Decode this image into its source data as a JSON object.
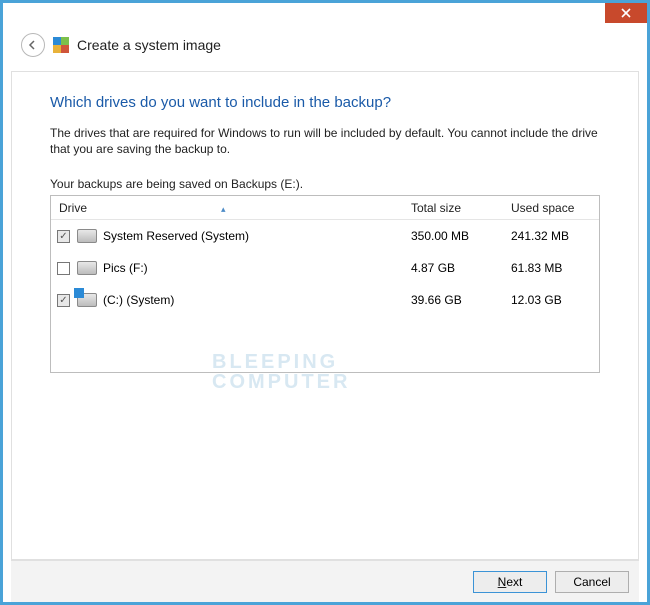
{
  "window": {
    "title": "Create a system image"
  },
  "content": {
    "question": "Which drives do you want to include in the backup?",
    "description": "The drives that are required for Windows to run will be included by default. You cannot include the drive that you are saving the backup to.",
    "save_location": "Your backups are being saved on Backups (E:)."
  },
  "table": {
    "headers": {
      "drive": "Drive",
      "total": "Total size",
      "used": "Used space"
    },
    "rows": [
      {
        "checked": true,
        "disabled": true,
        "system_badge": false,
        "name": "System Reserved (System)",
        "total": "350.00 MB",
        "used": "241.32 MB"
      },
      {
        "checked": false,
        "disabled": false,
        "system_badge": false,
        "name": "Pics (F:)",
        "total": "4.87 GB",
        "used": "61.83 MB"
      },
      {
        "checked": true,
        "disabled": true,
        "system_badge": true,
        "name": "(C:) (System)",
        "total": "39.66 GB",
        "used": "12.03 GB"
      }
    ]
  },
  "footer": {
    "next": "Next",
    "cancel": "Cancel"
  },
  "watermark": {
    "line1": "BLEEPING",
    "line2": "COMPUTER"
  }
}
